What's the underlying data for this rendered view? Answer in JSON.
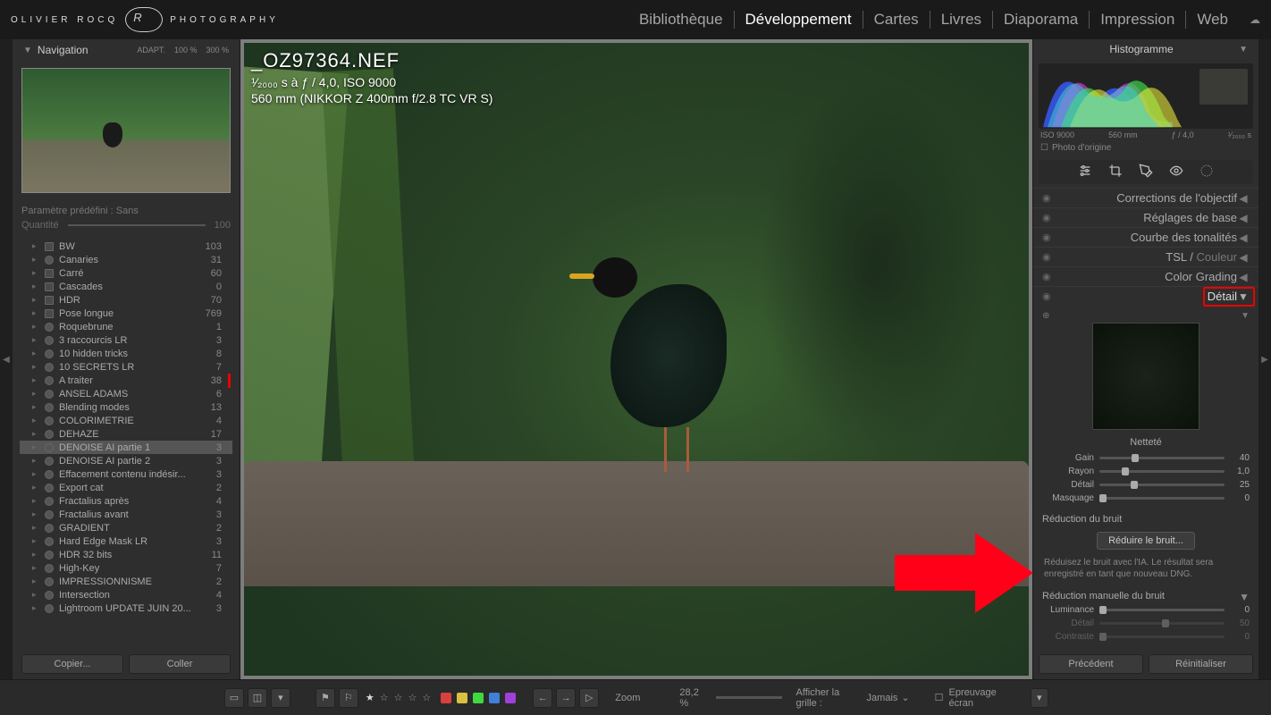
{
  "brand": {
    "left": "OLIVIER ROCQ",
    "right": "PHOTOGRAPHY"
  },
  "modules": {
    "library": "Bibliothèque",
    "develop": "Développement",
    "map": "Cartes",
    "book": "Livres",
    "slideshow": "Diaporama",
    "print": "Impression",
    "web": "Web"
  },
  "nav": {
    "title": "Navigation",
    "adapt": "ADAPT.",
    "z100": "100 %",
    "z300": "300 %"
  },
  "preset": {
    "label": "Paramètre prédéfini : Sans",
    "amount_label": "Quantité",
    "amount_value": "100"
  },
  "collections": [
    {
      "name": "BW",
      "count": "103",
      "smart": false
    },
    {
      "name": "Canaries",
      "count": "31",
      "smart": true
    },
    {
      "name": "Carré",
      "count": "60",
      "smart": false
    },
    {
      "name": "Cascades",
      "count": "0",
      "smart": false
    },
    {
      "name": "HDR",
      "count": "70",
      "smart": false
    },
    {
      "name": "Pose longue",
      "count": "769",
      "smart": false
    },
    {
      "name": "Roquebrune",
      "count": "1",
      "smart": true
    },
    {
      "name": "3 raccourcis LR",
      "count": "3",
      "smart": true
    },
    {
      "name": "10 hidden tricks",
      "count": "8",
      "smart": true
    },
    {
      "name": "10 SECRETS LR",
      "count": "7",
      "smart": true
    },
    {
      "name": "A traiter",
      "count": "38",
      "smart": true,
      "red": true
    },
    {
      "name": "ANSEL ADAMS",
      "count": "6",
      "smart": true
    },
    {
      "name": "Blending modes",
      "count": "13",
      "smart": true
    },
    {
      "name": "COLORIMETRIE",
      "count": "4",
      "smart": true
    },
    {
      "name": "DEHAZE",
      "count": "17",
      "smart": true
    },
    {
      "name": "DENOISE AI partie 1",
      "count": "3",
      "smart": true,
      "selected": true
    },
    {
      "name": "DENOISE AI partie 2",
      "count": "3",
      "smart": true
    },
    {
      "name": "Effacement contenu indésir...",
      "count": "3",
      "smart": true
    },
    {
      "name": "Export cat",
      "count": "2",
      "smart": true
    },
    {
      "name": "Fractalius après",
      "count": "4",
      "smart": true
    },
    {
      "name": "Fractalius avant",
      "count": "3",
      "smart": true
    },
    {
      "name": "GRADIENT",
      "count": "2",
      "smart": true
    },
    {
      "name": "Hard Edge Mask LR",
      "count": "3",
      "smart": true
    },
    {
      "name": "HDR 32 bits",
      "count": "11",
      "smart": true
    },
    {
      "name": "High-Key",
      "count": "7",
      "smart": true
    },
    {
      "name": "IMPRESSIONNISME",
      "count": "2",
      "smart": true
    },
    {
      "name": "Intersection",
      "count": "4",
      "smart": true
    },
    {
      "name": "Lightroom UPDATE JUIN 20...",
      "count": "3",
      "smart": true
    }
  ],
  "copy": {
    "copy_btn": "Copier...",
    "paste_btn": "Coller"
  },
  "image": {
    "filename": "_OZ97364.NEF",
    "exposure": "¹⁄₂₀₀₀ s à ƒ / 4,0, ISO 9000",
    "lens": "560 mm (NIKKOR Z 400mm f/2.8 TC VR S)"
  },
  "toolbar": {
    "zoom_label": "Zoom",
    "zoom_pct": "28,2 %",
    "grid_label": "Afficher la grille :",
    "grid_value": "Jamais",
    "proof": "Epreuvage écran"
  },
  "histogram": {
    "title": "Histogramme",
    "iso": "ISO 9000",
    "focal": "560 mm",
    "aperture": "ƒ / 4,0",
    "shutter": "¹⁄₂₀₀₀ s",
    "original": "Photo d'origine"
  },
  "panels": {
    "lens": "Corrections de l'objectif",
    "basic": "Réglages de base",
    "tone": "Courbe des tonalités",
    "tsl": "TSL",
    "color": "Couleur",
    "grading": "Color Grading",
    "detail": "Détail"
  },
  "sharpen": {
    "title": "Netteté",
    "gain_l": "Gain",
    "gain_v": "40",
    "rayon_l": "Rayon",
    "rayon_v": "1,0",
    "detail_l": "Détail",
    "detail_v": "25",
    "mask_l": "Masquage",
    "mask_v": "0"
  },
  "nr": {
    "title": "Réduction du bruit",
    "button": "Réduire le bruit...",
    "help": "Réduisez le bruit avec l'IA. Le résultat sera enregistré en tant que nouveau DNG.",
    "manual": "Réduction manuelle du bruit",
    "lum_l": "Luminance",
    "lum_v": "0",
    "det_l": "Détail",
    "det_v": "50",
    "con_l": "Contraste",
    "con_v": "0"
  },
  "right_buttons": {
    "prev": "Précédent",
    "reset": "Réinitialiser"
  }
}
